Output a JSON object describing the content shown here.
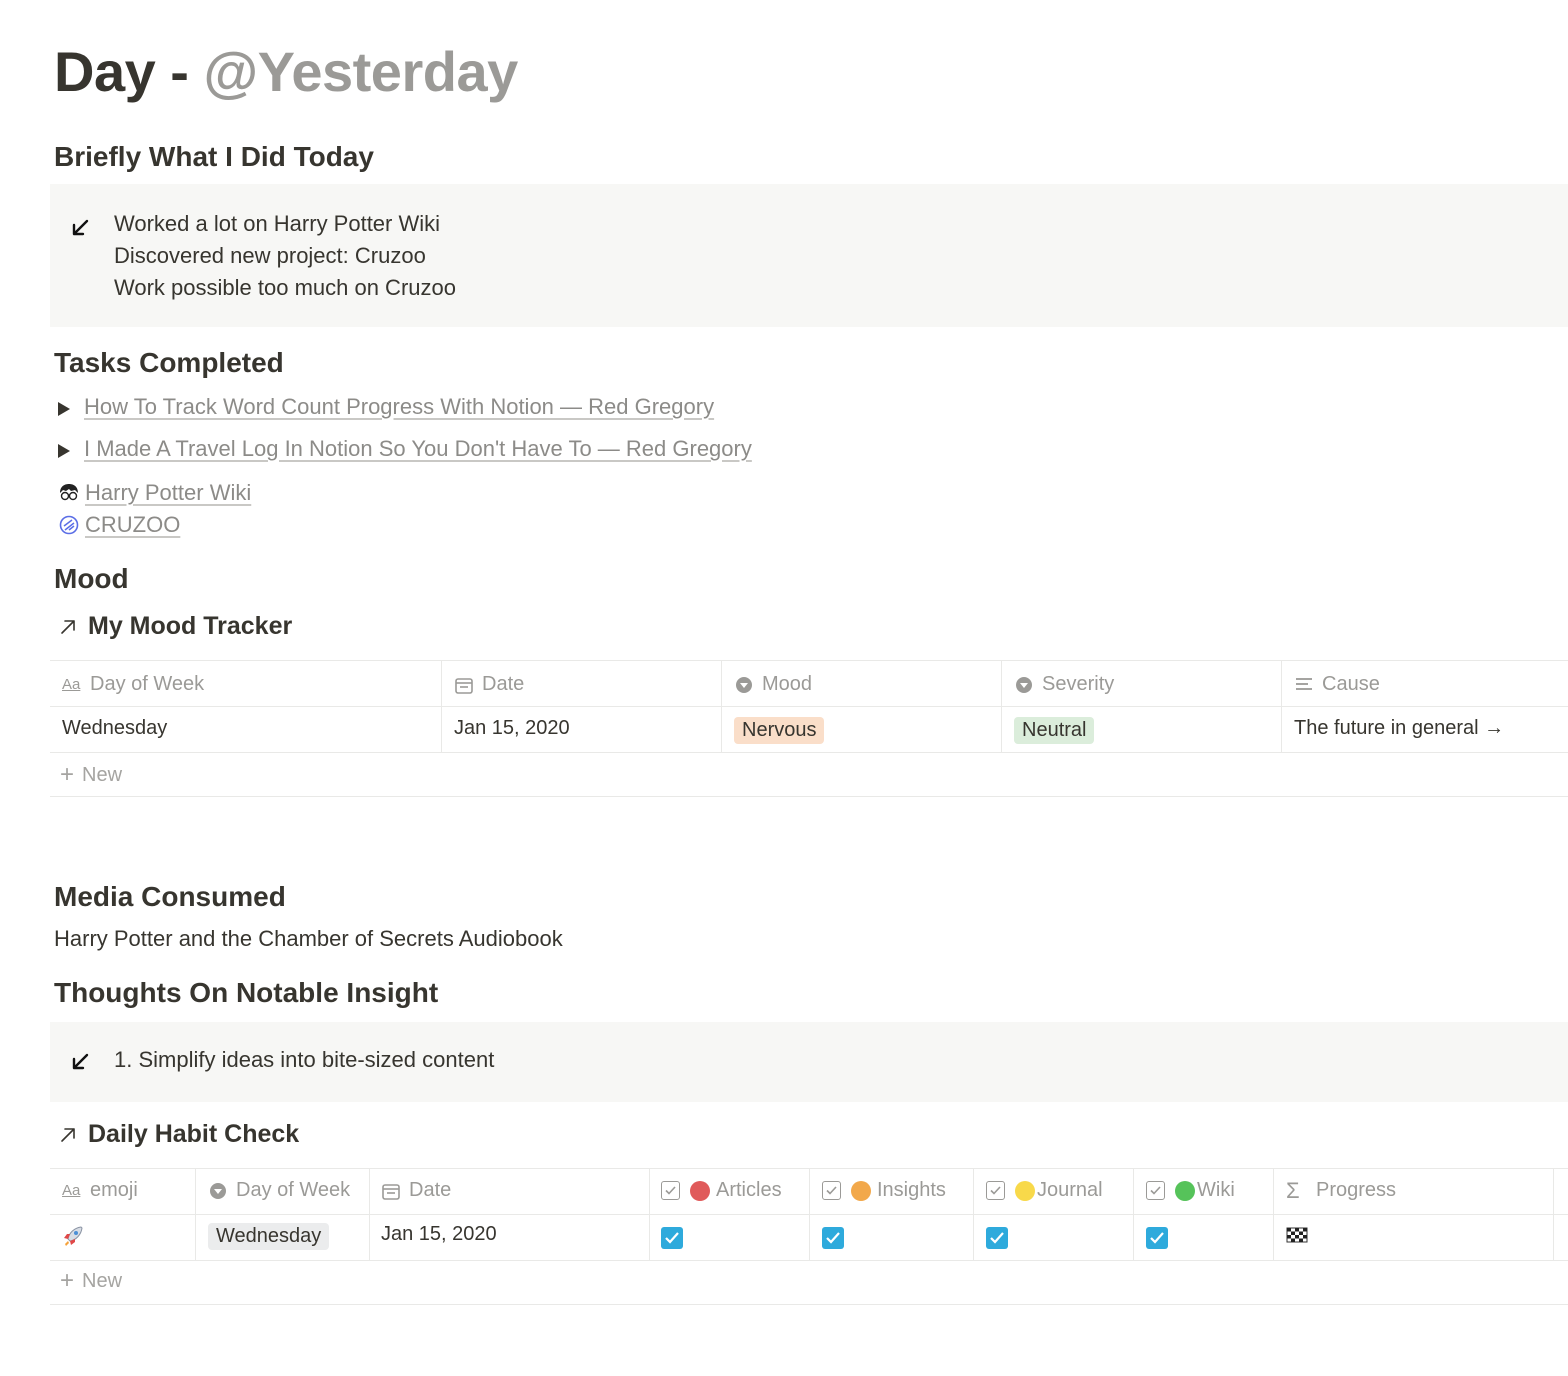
{
  "page": {
    "title_prefix": "Day - ",
    "title_mention": "@Yesterday"
  },
  "briefly": {
    "heading": "Briefly What I Did Today",
    "lines": [
      "Worked a lot on Harry Potter Wiki",
      "Discovered new project: Cruzoo",
      "Work possible too much on Cruzoo"
    ]
  },
  "tasks": {
    "heading": "Tasks Completed",
    "toggles": [
      "How To Track Word Count Progress With Notion — Red Gregory",
      "I Made A Travel Log In Notion So You Don't Have To — Red Gregory"
    ],
    "mentions": [
      "Harry Potter Wiki",
      "CRUZOO"
    ]
  },
  "mood": {
    "heading": "Mood",
    "tracker_title": "My Mood Tracker",
    "columns": [
      "Day of Week",
      "Date",
      "Mood",
      "Severity",
      "Cause"
    ],
    "row": {
      "day": "Wednesday",
      "date": "Jan 15, 2020",
      "mood": "Nervous",
      "severity": "Neutral",
      "cause": "The future in general →"
    },
    "new_label": "New",
    "mood_color": "#fadec9",
    "severity_color": "#dbeddb"
  },
  "media": {
    "heading": "Media Consumed",
    "text": "Harry Potter and the Chamber of Secrets Audiobook"
  },
  "insight": {
    "heading": "Thoughts On Notable Insight",
    "text": "1. Simplify ideas into bite-sized content"
  },
  "habit": {
    "title": "Daily Habit Check",
    "columns": [
      "emoji",
      "Day of Week",
      "Date",
      "Articles",
      "Insights",
      "Journal",
      "Wiki",
      "Progress"
    ],
    "row": {
      "day": "Wednesday",
      "date": "Jan 15, 2020"
    },
    "new_label": "New",
    "check_color": "#2eaadc"
  }
}
